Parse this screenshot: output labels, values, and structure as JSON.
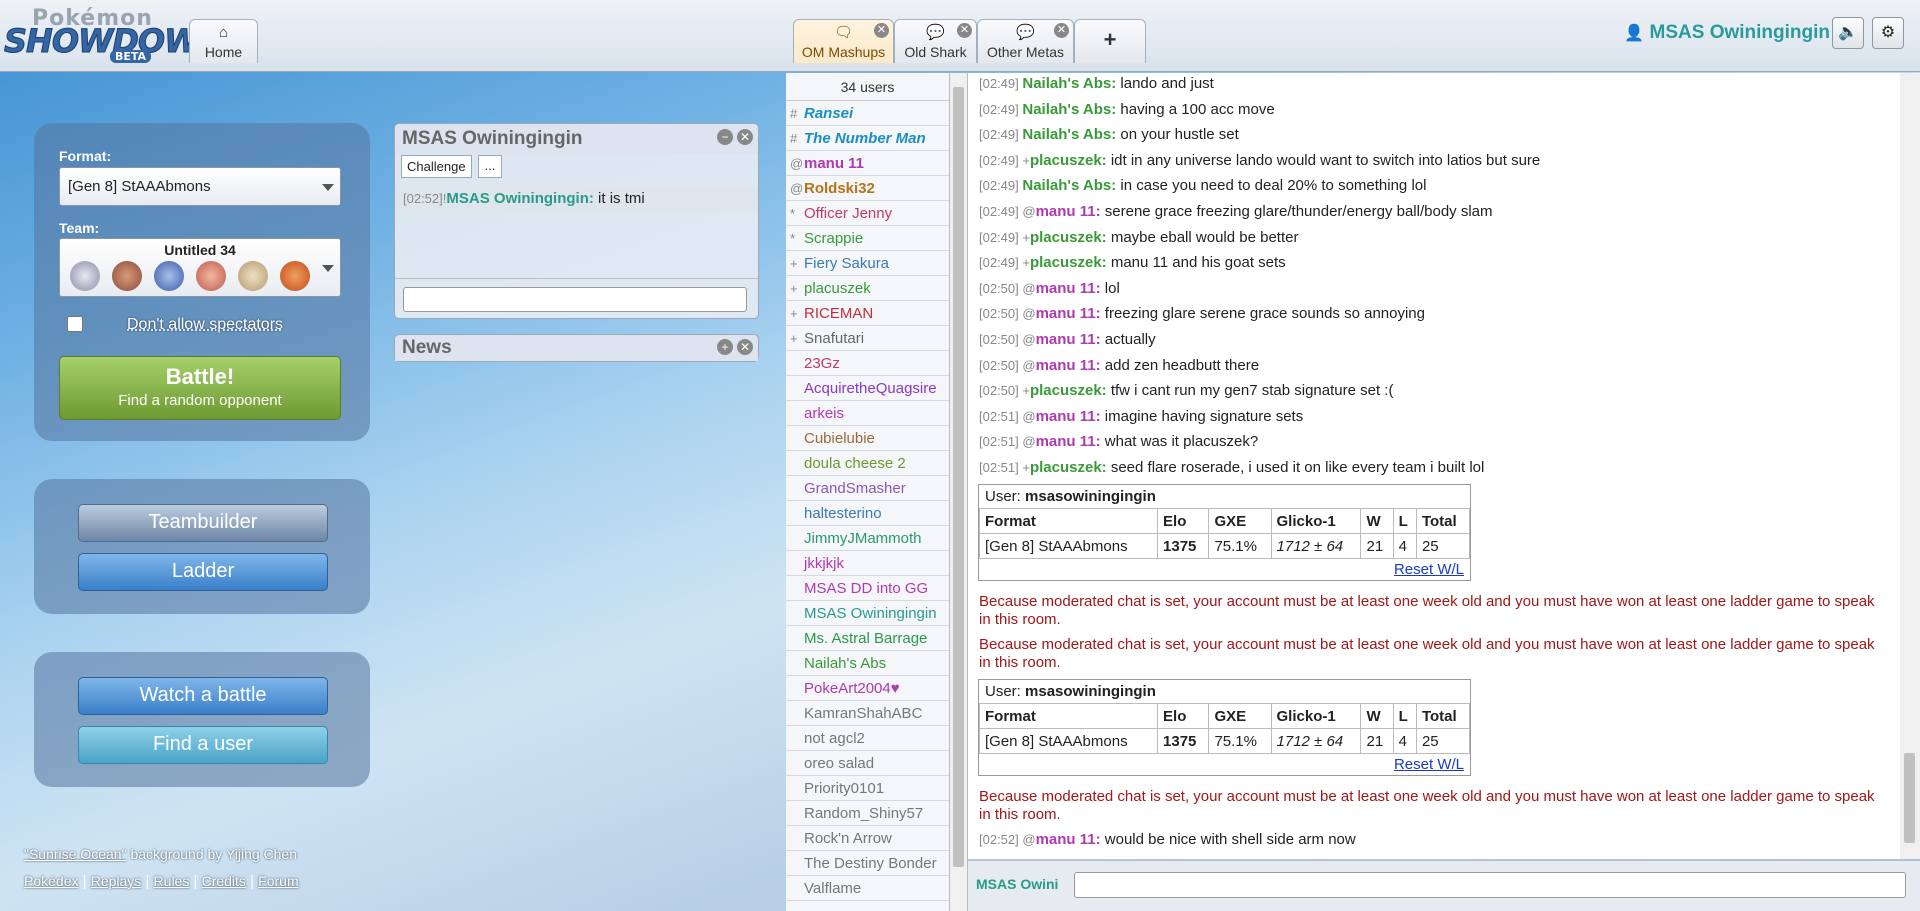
{
  "header": {
    "logo": {
      "line1": "Pokémon",
      "line2": "SHOWDOWN",
      "line3": "BETA"
    },
    "home_tab": {
      "icon": "home-icon",
      "label": "Home"
    },
    "room_tabs": [
      {
        "label": "OM Mashups",
        "icon": "chat-bubbles-icon",
        "active": true
      },
      {
        "label": "Old Shark",
        "icon": "chat-bubble-icon",
        "active": false
      },
      {
        "label": "Other Metas",
        "icon": "chat-bubble-icon",
        "active": false
      }
    ],
    "close_glyph": "✕",
    "add_tab": "+",
    "username": "MSAS Owiningingin",
    "sound_icon": "sound-icon",
    "settings_icon": "gear-icon"
  },
  "colors": {
    "accent": "#2a9a9a",
    "battle_green": "#8bbd4f",
    "system_red": "#a01818"
  },
  "left": {
    "format_label": "Format:",
    "format_value": "[Gen 8] StAAAbmons",
    "team_label": "Team:",
    "team_name": "Untitled 34",
    "team_sprites": [
      "pokemon-sprite-1",
      "pokemon-sprite-2",
      "pokemon-sprite-3",
      "pokemon-sprite-4",
      "pokemon-sprite-5",
      "pokemon-sprite-6"
    ],
    "spectators_label": "Don't allow spectators",
    "battle_title": "Battle!",
    "battle_sub": "Find a random opponent",
    "teambuilder": "Teambuilder",
    "ladder": "Ladder",
    "watch": "Watch a battle",
    "find_user": "Find a user",
    "bg_credit_title": "\"Sunrise Ocean\"",
    "bg_credit_rest": "background by Yijing Chen",
    "footer_links": [
      "Pokédex",
      "Replays",
      "Rules",
      "Credits",
      "Forum"
    ]
  },
  "pm": {
    "title": "MSAS Owiningingin",
    "challenge": "Challenge",
    "more": "...",
    "ts": "[02:52]",
    "rank": "!",
    "name": "MSAS Owiningingin:",
    "msg": "it is tmi",
    "minimize": "−",
    "close": "✕"
  },
  "news": {
    "title": "News",
    "expand": "+",
    "close": "✕"
  },
  "userlist": {
    "count": "34 users",
    "users": [
      {
        "g": "#",
        "name": "Ransei",
        "color": "#1a8fc0",
        "style": "bi"
      },
      {
        "g": "#",
        "name": "The Number Man",
        "color": "#1a8fc0",
        "style": "bi"
      },
      {
        "g": "@",
        "name": "manu 11",
        "color": "#b03ab0",
        "style": "b"
      },
      {
        "g": "@",
        "name": "Roldski32",
        "color": "#b8741a",
        "style": "b"
      },
      {
        "g": "*",
        "name": "Officer Jenny",
        "color": "#c03a68",
        "style": ""
      },
      {
        "g": "*",
        "name": "Scrappie",
        "color": "#3a9a3a",
        "style": ""
      },
      {
        "g": "+",
        "name": "Fiery Sakura",
        "color": "#3a7ab8",
        "style": ""
      },
      {
        "g": "+",
        "name": "placuszek",
        "color": "#3a9a3a",
        "style": ""
      },
      {
        "g": "+",
        "name": "RICEMAN",
        "color": "#c0303a",
        "style": ""
      },
      {
        "g": "+",
        "name": "Snafutari",
        "color": "#666666",
        "style": ""
      },
      {
        "g": "",
        "name": "23Gz",
        "color": "#c03a68",
        "style": ""
      },
      {
        "g": "",
        "name": "AcquiretheQuagsire",
        "color": "#8a3ac0",
        "style": ""
      },
      {
        "g": "",
        "name": "arkeis",
        "color": "#b03ab0",
        "style": ""
      },
      {
        "g": "",
        "name": "Cubielubie",
        "color": "#9a6a3a",
        "style": ""
      },
      {
        "g": "",
        "name": "doula cheese 2",
        "color": "#6a9a2a",
        "style": ""
      },
      {
        "g": "",
        "name": "GrandSmasher",
        "color": "#8a5ab8",
        "style": ""
      },
      {
        "g": "",
        "name": "haltesterino",
        "color": "#3a7ab8",
        "style": ""
      },
      {
        "g": "",
        "name": "JimmyJMammoth",
        "color": "#2a9a6a",
        "style": ""
      },
      {
        "g": "",
        "name": "jkkjkjk",
        "color": "#b03ab0",
        "style": ""
      },
      {
        "g": "",
        "name": "MSAS DD into GG",
        "color": "#b03ab0",
        "style": ""
      },
      {
        "g": "",
        "name": "MSAS Owiningingin",
        "color": "#2a9a8a",
        "style": ""
      },
      {
        "g": "",
        "name": "Ms. Astral Barrage",
        "color": "#2a9a4a",
        "style": ""
      },
      {
        "g": "",
        "name": "Nailah's Abs",
        "color": "#3a9a3a",
        "style": ""
      },
      {
        "g": "",
        "name": "PokeArt2004♥",
        "color": "#b03ab0",
        "style": ""
      },
      {
        "g": "",
        "name": "KamranShahABC",
        "color": "#777777",
        "style": ""
      },
      {
        "g": "",
        "name": "not agcl2",
        "color": "#777777",
        "style": ""
      },
      {
        "g": "",
        "name": "oreo salad",
        "color": "#777777",
        "style": ""
      },
      {
        "g": "",
        "name": "Priority0101",
        "color": "#777777",
        "style": ""
      },
      {
        "g": "",
        "name": "Random_Shiny57",
        "color": "#777777",
        "style": ""
      },
      {
        "g": "",
        "name": "Rock'n Arrow",
        "color": "#777777",
        "style": ""
      },
      {
        "g": "",
        "name": "The Destiny Bonder",
        "color": "#777777",
        "style": ""
      },
      {
        "g": "",
        "name": "Valflame",
        "color": "#777777",
        "style": ""
      }
    ]
  },
  "chat": {
    "lines": [
      {
        "ts": "[02:49]",
        "g": "",
        "name": "Nailah's Abs:",
        "color": "#3a9a3a",
        "msg": "lando and just"
      },
      {
        "ts": "[02:49]",
        "g": "",
        "name": "Nailah's Abs:",
        "color": "#3a9a3a",
        "msg": "having a 100 acc move"
      },
      {
        "ts": "[02:49]",
        "g": "",
        "name": "Nailah's Abs:",
        "color": "#3a9a3a",
        "msg": "on your hustle set"
      },
      {
        "ts": "[02:49]",
        "g": "+",
        "name": "placuszek:",
        "color": "#3a9a3a",
        "msg": "idt in any universe lando would want to switch into latios but sure"
      },
      {
        "ts": "[02:49]",
        "g": "",
        "name": "Nailah's Abs:",
        "color": "#3a9a3a",
        "msg": "in case you need to deal 20% to something lol"
      },
      {
        "ts": "[02:49]",
        "g": "@",
        "name": "manu 11:",
        "color": "#b03ab0",
        "msg": "serene grace freezing glare/thunder/energy ball/body slam"
      },
      {
        "ts": "[02:49]",
        "g": "+",
        "name": "placuszek:",
        "color": "#3a9a3a",
        "msg": "maybe eball would be better"
      },
      {
        "ts": "[02:49]",
        "g": "+",
        "name": "placuszek:",
        "color": "#3a9a3a",
        "msg": "manu 11 and his goat sets"
      },
      {
        "ts": "[02:50]",
        "g": "@",
        "name": "manu 11:",
        "color": "#b03ab0",
        "msg": "lol"
      },
      {
        "ts": "[02:50]",
        "g": "@",
        "name": "manu 11:",
        "color": "#b03ab0",
        "msg": "freezing glare serene grace sounds so annoying"
      },
      {
        "ts": "[02:50]",
        "g": "@",
        "name": "manu 11:",
        "color": "#b03ab0",
        "msg": "actually"
      },
      {
        "ts": "[02:50]",
        "g": "@",
        "name": "manu 11:",
        "color": "#b03ab0",
        "msg": "add zen headbutt there"
      },
      {
        "ts": "[02:50]",
        "g": "+",
        "name": "placuszek:",
        "color": "#3a9a3a",
        "msg": "tfw i cant run my gen7 stab signature set :("
      },
      {
        "ts": "[02:51]",
        "g": "@",
        "name": "manu 11:",
        "color": "#b03ab0",
        "msg": "imagine having signature sets"
      },
      {
        "ts": "[02:51]",
        "g": "@",
        "name": "manu 11:",
        "color": "#b03ab0",
        "msg": "what was it placuszek?"
      },
      {
        "ts": "[02:51]",
        "g": "+",
        "name": "placuszek:",
        "color": "#3a9a3a",
        "msg": "seed flare roserade, i used it on like every team i built lol"
      }
    ],
    "rank_table": {
      "user_label": "User:",
      "user": "msasowiningingin",
      "headers": [
        "Format",
        "Elo",
        "GXE",
        "Glicko-1",
        "W",
        "L",
        "Total"
      ],
      "row": [
        "[Gen 8] StAAAbmons",
        "1375",
        "75.1%",
        "1712 ± 64",
        "21",
        "4",
        "25"
      ],
      "reset": "Reset W/L"
    },
    "moderated_msg": "Because moderated chat is set, your account must be at least one week old and you must have won at least one ladder game to speak in this room.",
    "last_line": {
      "ts": "[02:52]",
      "g": "@",
      "name": "manu 11:",
      "color": "#b03ab0",
      "msg": "would be nice with shell side arm now"
    },
    "input_user": "MSAS Owini",
    "input_value": ""
  }
}
